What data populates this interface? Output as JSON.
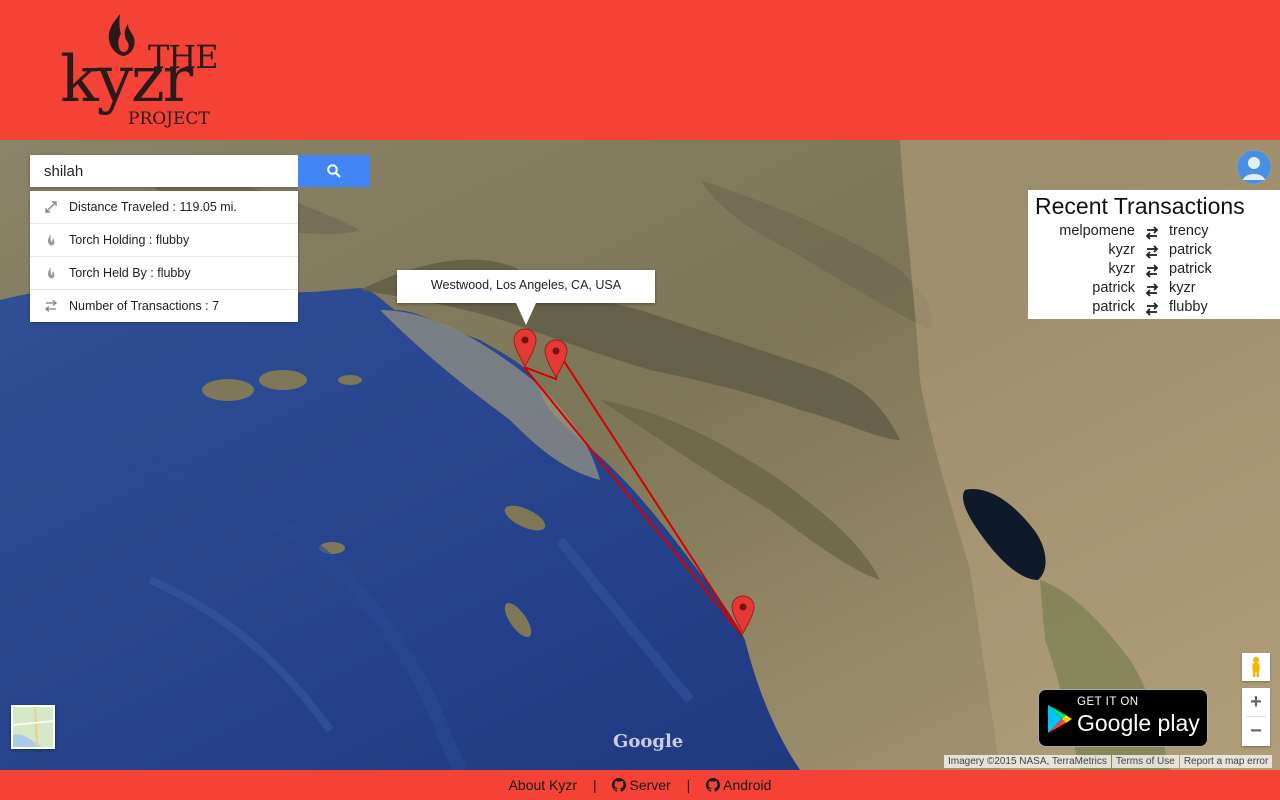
{
  "header": {
    "logo": {
      "line1": "THE",
      "line2": "kyzr",
      "line3": "PROJECT"
    }
  },
  "search": {
    "value": "shilah",
    "placeholder": "",
    "button_icon": "search-icon"
  },
  "stats": [
    {
      "icon": "distance-icon",
      "label": "Distance Traveled : 119.05 mi."
    },
    {
      "icon": "flame-icon",
      "label": "Torch Holding : flubby"
    },
    {
      "icon": "flame-icon",
      "label": "Torch Held By : flubby"
    },
    {
      "icon": "swap-icon",
      "label": "Number of Transactions : 7"
    }
  ],
  "recent_transactions": {
    "title": "Recent Transactions",
    "rows": [
      {
        "from": "melpomene",
        "to": "trency"
      },
      {
        "from": "kyzr",
        "to": "patrick"
      },
      {
        "from": "kyzr",
        "to": "patrick"
      },
      {
        "from": "patrick",
        "to": "kyzr"
      },
      {
        "from": "patrick",
        "to": "flubby"
      }
    ]
  },
  "map": {
    "info_window_text": "Westwood, Los Angeles, CA, USA",
    "google_mark": "Google",
    "attribution": {
      "imagery": "Imagery ©2015 NASA, TerraMetrics",
      "terms": "Terms of Use",
      "report": "Report a map error"
    },
    "zoom_in": "+",
    "zoom_out": "−",
    "route_color": "#d50000",
    "pin_color": "#e53935"
  },
  "play_badge": {
    "line1": "GET IT ON",
    "line2": "Google play"
  },
  "footer": {
    "about": "About Kyzr",
    "server": "Server",
    "android": "Android",
    "separator": "|"
  },
  "colors": {
    "brand": "#f44336",
    "search_button": "#4285f4"
  }
}
